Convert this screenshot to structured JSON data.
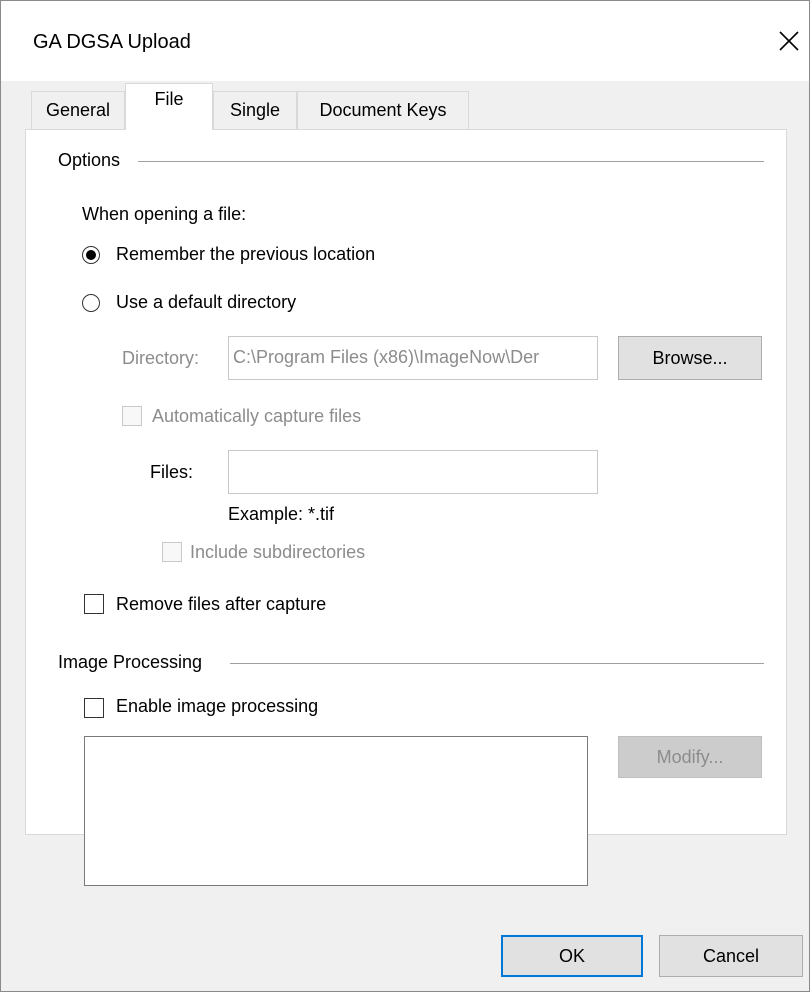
{
  "window": {
    "title": "GA DGSA Upload"
  },
  "tabs": [
    {
      "label": "General",
      "active": false
    },
    {
      "label": "File",
      "active": true
    },
    {
      "label": "Single",
      "active": false
    },
    {
      "label": "Document Keys",
      "active": false
    }
  ],
  "options": {
    "group_label": "Options",
    "when_opening_label": "When opening a file:",
    "radio_remember": {
      "label": "Remember the previous location",
      "selected": true
    },
    "radio_default_dir": {
      "label": "Use a default directory",
      "selected": false
    },
    "directory": {
      "label": "Directory:",
      "value": "C:\\Program Files (x86)\\ImageNow\\Der",
      "browse_label": "Browse..."
    },
    "auto_capture": {
      "label": "Automatically capture files",
      "checked": false,
      "enabled": false
    },
    "files": {
      "label": "Files:",
      "value": "",
      "example": "Example: *.tif"
    },
    "include_subdirs": {
      "label": "Include subdirectories",
      "checked": false,
      "enabled": false
    },
    "remove_after_capture": {
      "label": "Remove files after capture",
      "checked": false
    }
  },
  "image_processing": {
    "group_label": "Image Processing",
    "enable": {
      "label": "Enable image processing",
      "checked": false
    },
    "modify_label": "Modify..."
  },
  "footer": {
    "ok_label": "OK",
    "cancel_label": "Cancel"
  }
}
